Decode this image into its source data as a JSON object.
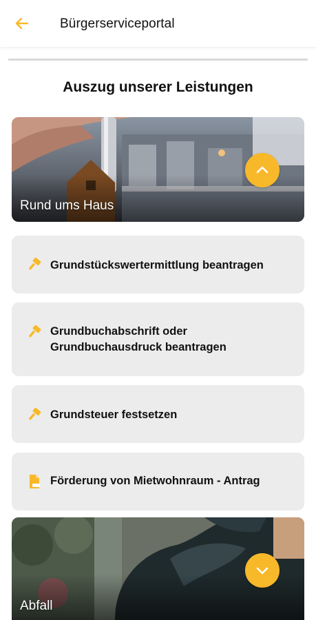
{
  "appbar": {
    "title": "Bürgerserviceportal",
    "back_icon": "arrow-left-icon"
  },
  "section": {
    "title": "Auszug unserer Leistungen"
  },
  "categories": [
    {
      "label": "Rund ums Haus",
      "expanded": true,
      "toggle_icon": "chevron-up-icon"
    },
    {
      "label": "Abfall",
      "expanded": false,
      "toggle_icon": "chevron-down-icon"
    }
  ],
  "services": [
    {
      "label": "Grundstückswertermittlung beantragen",
      "icon": "hammer-icon"
    },
    {
      "label": "Grundbuchabschrift oder Grundbuchausdruck beantragen",
      "icon": "hammer-icon"
    },
    {
      "label": "Grundsteuer festsetzen",
      "icon": "hammer-icon"
    },
    {
      "label": "Förderung von Mietwohnraum - Antrag",
      "icon": "pdf-file-icon"
    }
  ],
  "colors": {
    "accent": "#f7b92a",
    "card_bg": "#ececec"
  }
}
